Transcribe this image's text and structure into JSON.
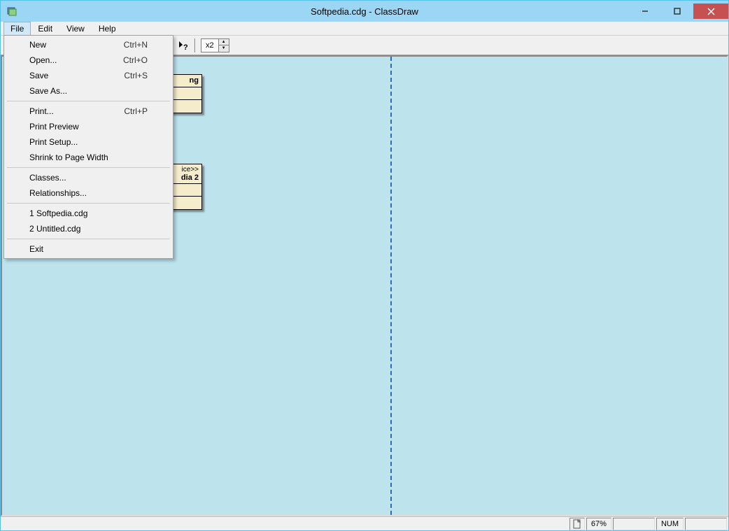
{
  "window": {
    "title": "Softpedia.cdg - ClassDraw"
  },
  "menubar": {
    "file": "File",
    "edit": "Edit",
    "view": "View",
    "help": "Help"
  },
  "file_menu": {
    "new": {
      "label": "New",
      "shortcut": "Ctrl+N"
    },
    "open": {
      "label": "Open...",
      "shortcut": "Ctrl+O"
    },
    "save": {
      "label": "Save",
      "shortcut": "Ctrl+S"
    },
    "save_as": {
      "label": "Save As..."
    },
    "print": {
      "label": "Print...",
      "shortcut": "Ctrl+P"
    },
    "print_preview": {
      "label": "Print Preview"
    },
    "print_setup": {
      "label": "Print Setup..."
    },
    "shrink": {
      "label": "Shrink to Page Width"
    },
    "classes": {
      "label": "Classes..."
    },
    "relationships": {
      "label": "Relationships..."
    },
    "recent1": {
      "label": "1 Softpedia.cdg"
    },
    "recent2": {
      "label": "2 Untitled.cdg"
    },
    "exit": {
      "label": "Exit"
    }
  },
  "toolbar": {
    "zoom_value": "x2"
  },
  "canvas": {
    "class1": {
      "name_partial": "ng"
    },
    "class2": {
      "stereo_partial": "ice>>",
      "name_partial": "dia 2"
    }
  },
  "statusbar": {
    "zoom": "67%",
    "num": "NUM"
  }
}
